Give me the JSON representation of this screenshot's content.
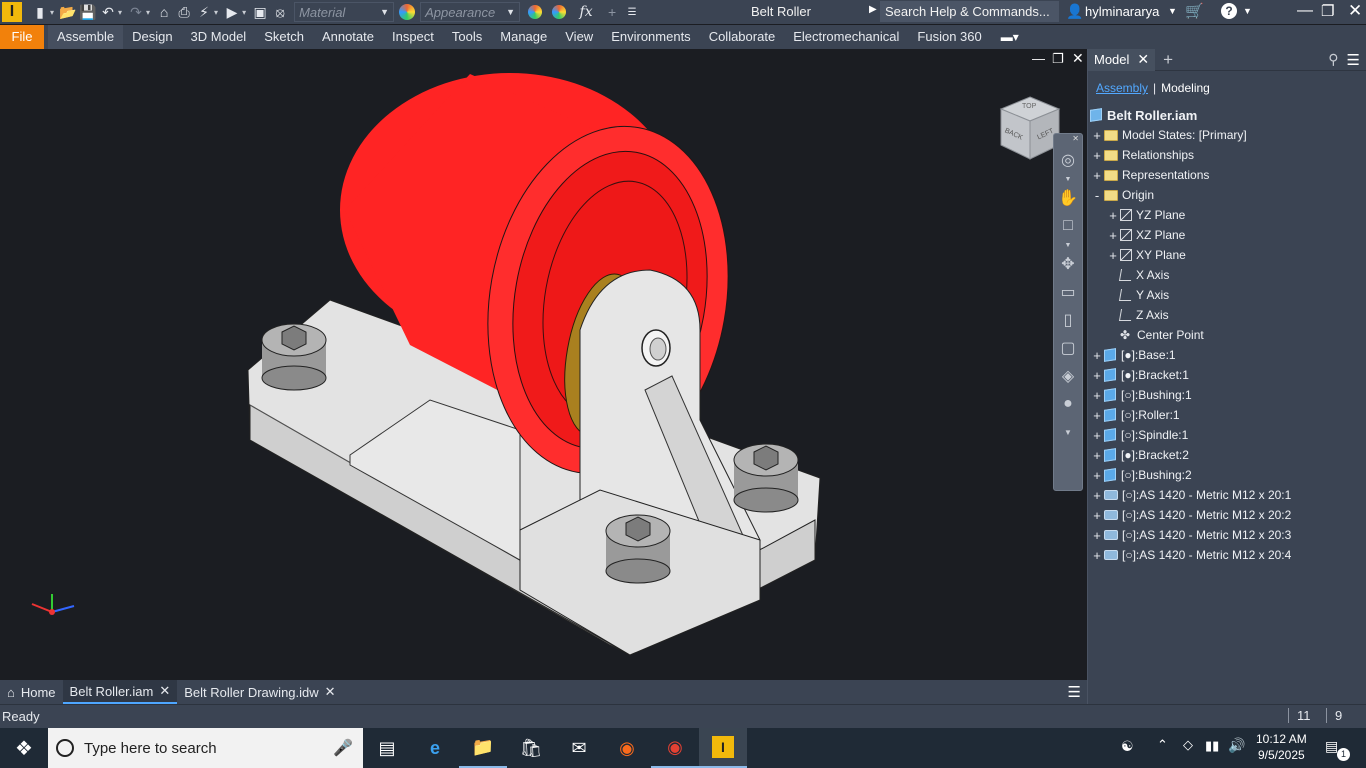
{
  "app": {
    "title": "Belt Roller",
    "search_placeholder": "Search Help & Commands...",
    "user": "hylminararya",
    "logo_letter": "I"
  },
  "qat": {
    "material_placeholder": "Material",
    "appearance_placeholder": "Appearance"
  },
  "ribbon_tabs": [
    "File",
    "Assemble",
    "Design",
    "3D Model",
    "Sketch",
    "Annotate",
    "Inspect",
    "Tools",
    "Manage",
    "View",
    "Environments",
    "Collaborate",
    "Electromechanical",
    "Fusion 360"
  ],
  "active_tab": "Assemble",
  "browser": {
    "tab_label": "Model",
    "sub_tabs": [
      "Assembly",
      "Modeling"
    ],
    "root": "Belt Roller.iam",
    "items": [
      {
        "label": "Model States: [Primary]",
        "icon": "folder-icon",
        "level": 0,
        "expander": "+"
      },
      {
        "label": "Relationships",
        "icon": "folder-icon",
        "level": 0,
        "expander": "+"
      },
      {
        "label": "Representations",
        "icon": "folder-icon",
        "level": 0,
        "expander": "+"
      },
      {
        "label": "Origin",
        "icon": "folder-open-icon",
        "level": 0,
        "expander": "-"
      },
      {
        "label": "YZ Plane",
        "icon": "plane-icon",
        "level": 1,
        "expander": "+"
      },
      {
        "label": "XZ Plane",
        "icon": "plane-icon",
        "level": 1,
        "expander": "+"
      },
      {
        "label": "XY Plane",
        "icon": "plane-icon",
        "level": 1,
        "expander": "+"
      },
      {
        "label": "X Axis",
        "icon": "axis-icon",
        "level": 1,
        "expander": ""
      },
      {
        "label": "Y Axis",
        "icon": "axis-icon",
        "level": 1,
        "expander": ""
      },
      {
        "label": "Z Axis",
        "icon": "axis-icon",
        "level": 1,
        "expander": ""
      },
      {
        "label": "Center Point",
        "icon": "point-icon",
        "level": 1,
        "expander": ""
      },
      {
        "label": "[●]:Base:1",
        "icon": "part-icon",
        "level": 0,
        "expander": "+"
      },
      {
        "label": "[●]:Bracket:1",
        "icon": "part-icon",
        "level": 0,
        "expander": "+"
      },
      {
        "label": "[○]:Bushing:1",
        "icon": "part-icon",
        "level": 0,
        "expander": "+"
      },
      {
        "label": "[○]:Roller:1",
        "icon": "part-icon",
        "level": 0,
        "expander": "+"
      },
      {
        "label": "[○]:Spindle:1",
        "icon": "part-icon",
        "level": 0,
        "expander": "+"
      },
      {
        "label": "[●]:Bracket:2",
        "icon": "part-icon",
        "level": 0,
        "expander": "+"
      },
      {
        "label": "[○]:Bushing:2",
        "icon": "part-icon",
        "level": 0,
        "expander": "+"
      },
      {
        "label": "[○]:AS 1420 - Metric M12 x 20:1",
        "icon": "bolt-icon",
        "level": 0,
        "expander": "+"
      },
      {
        "label": "[○]:AS 1420 - Metric M12 x 20:2",
        "icon": "bolt-icon",
        "level": 0,
        "expander": "+"
      },
      {
        "label": "[○]:AS 1420 - Metric M12 x 20:3",
        "icon": "bolt-icon",
        "level": 0,
        "expander": "+"
      },
      {
        "label": "[○]:AS 1420 - Metric M12 x 20:4",
        "icon": "bolt-icon",
        "level": 0,
        "expander": "+"
      }
    ]
  },
  "viewcube": {
    "faces": [
      "BACK",
      "LEFT",
      "TOP"
    ]
  },
  "doc_tabs": [
    {
      "label": "Home",
      "active": false
    },
    {
      "label": "Belt Roller.iam",
      "active": true
    },
    {
      "label": "Belt Roller Drawing.idw",
      "active": false
    }
  ],
  "status": {
    "text": "Ready",
    "num1": "11",
    "num2": "9"
  },
  "taskbar": {
    "search_placeholder": "Type here to search",
    "time": "10:12 AM",
    "date": "9/5/2025",
    "notifications": "1"
  },
  "colors": {
    "roller": "#ff2424",
    "bushing": "#a9801f",
    "base": "#e3e3e3",
    "accent": "#f2810b",
    "viewport": "#1b1d22"
  }
}
